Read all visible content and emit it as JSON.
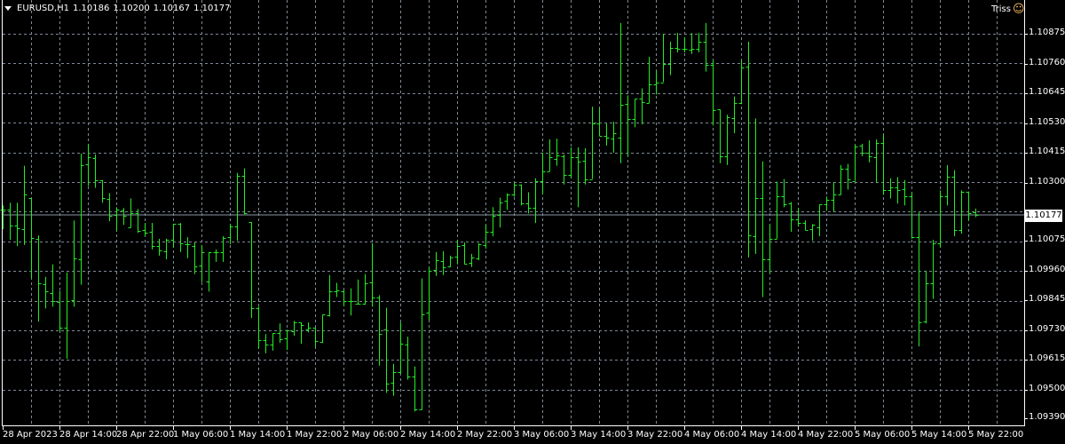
{
  "header": {
    "symbol_tf": "EURUSD,H1",
    "open": "1.10186",
    "high": "1.10200",
    "low": "1.10167",
    "close": "1.10177"
  },
  "expert": {
    "name": "Triss",
    "icon": "smiley-icon"
  },
  "colors": {
    "bar": "#22ee22",
    "grid": "#7d8896",
    "price_line": "#8a96a6",
    "background": "#000000"
  },
  "chart_data": {
    "type": "ohlc",
    "title": "EURUSD,H1",
    "ylim": [
      1.0939,
      1.10875
    ],
    "grid": true,
    "current_price": "1.10177",
    "y_ticks": [
      "1.10875",
      "1.10760",
      "1.10645",
      "1.10530",
      "1.10415",
      "1.10300",
      "1.10075",
      "1.09960",
      "1.09845",
      "1.09730",
      "1.09615",
      "1.09500",
      "1.09390"
    ],
    "x_ticks": [
      "28 Apr 2023",
      "28 Apr 14:00",
      "28 Apr 22:00",
      "1 May 06:00",
      "1 May 14:00",
      "1 May 22:00",
      "2 May 06:00",
      "2 May 14:00",
      "2 May 22:00",
      "3 May 06:00",
      "3 May 14:00",
      "3 May 22:00",
      "4 May 06:00",
      "4 May 14:00",
      "4 May 22:00",
      "5 May 06:00",
      "5 May 14:00",
      "5 May 22:00"
    ],
    "ohlc_fields": [
      "open",
      "high",
      "low",
      "close"
    ],
    "ohlc": [
      [
        1.10195,
        1.10212,
        1.1012,
        1.10195
      ],
      [
        1.10195,
        1.10222,
        1.10079,
        1.10134
      ],
      [
        1.10134,
        1.10222,
        1.10055,
        1.10123
      ],
      [
        1.1012,
        1.10365,
        1.10059,
        1.10253
      ],
      [
        1.10239,
        1.10239,
        1.0993,
        1.10086
      ],
      [
        1.10083,
        1.10096,
        1.09763,
        1.09913
      ],
      [
        1.09909,
        1.09936,
        1.09814,
        1.09879
      ],
      [
        1.09875,
        1.09984,
        1.09821,
        1.09841
      ],
      [
        1.09838,
        1.09882,
        1.09722,
        1.09739
      ],
      [
        1.09739,
        1.09953,
        1.0962,
        1.09841
      ],
      [
        1.09845,
        1.10154,
        1.09821,
        1.10008
      ],
      [
        1.10004,
        1.10412,
        1.09906,
        1.10368
      ],
      [
        1.10372,
        1.1045,
        1.10287,
        1.10399
      ],
      [
        1.10395,
        1.10409,
        1.1028,
        1.1031
      ],
      [
        1.1031,
        1.1031,
        1.10222,
        1.10239
      ],
      [
        1.10236,
        1.10259,
        1.10151,
        1.10171
      ],
      [
        1.10174,
        1.10205,
        1.10113,
        1.10195
      ],
      [
        1.10191,
        1.10202,
        1.10137,
        1.10171
      ],
      [
        1.10127,
        1.10239,
        1.10127,
        1.10181
      ],
      [
        1.10181,
        1.10198,
        1.10106,
        1.10113
      ],
      [
        1.10117,
        1.10144,
        1.10093,
        1.10106
      ],
      [
        1.1011,
        1.10144,
        1.10042,
        1.10055
      ],
      [
        1.10055,
        1.10083,
        1.10018,
        1.10038
      ],
      [
        1.10035,
        1.10083,
        1.10004,
        1.10079
      ],
      [
        1.10079,
        1.1014,
        1.10049,
        1.1014
      ],
      [
        1.1014,
        1.10144,
        1.10032,
        1.10066
      ],
      [
        1.10062,
        1.10089,
        1.10008,
        1.10062
      ],
      [
        1.10055,
        1.10069,
        1.09947,
        1.09977
      ],
      [
        1.09981,
        1.10059,
        1.09916,
        1.10032
      ],
      [
        1.09919,
        1.10032,
        1.09879,
        1.10032
      ],
      [
        1.10032,
        1.10042,
        1.09994,
        1.10032
      ],
      [
        1.10032,
        1.10093,
        1.09994,
        1.10086
      ],
      [
        1.10089,
        1.1014,
        1.10062,
        1.1013
      ],
      [
        1.1013,
        1.10338,
        1.10076,
        1.10327
      ],
      [
        1.10327,
        1.10355,
        1.10178,
        1.10181
      ],
      [
        1.10147,
        1.10147,
        1.09777,
        1.09814
      ],
      [
        1.09814,
        1.09821,
        1.09658,
        1.09692
      ],
      [
        1.09692,
        1.09715,
        1.09641,
        1.09675
      ],
      [
        1.09675,
        1.09719,
        1.09651,
        1.09719
      ],
      [
        1.09719,
        1.09756,
        1.09681,
        1.09695
      ],
      [
        1.09698,
        1.09732,
        1.09654,
        1.09729
      ],
      [
        1.09726,
        1.09766,
        1.09709,
        1.0976
      ],
      [
        1.0976,
        1.0976,
        1.09678,
        1.09749
      ],
      [
        1.09732,
        1.0976,
        1.09722,
        1.09739
      ],
      [
        1.09739,
        1.09739,
        1.09664,
        1.09688
      ],
      [
        1.09685,
        1.0979,
        1.09681,
        1.0979
      ],
      [
        1.09787,
        1.09943,
        1.09783,
        1.09882
      ],
      [
        1.09882,
        1.09913,
        1.09858,
        1.09885
      ],
      [
        1.09882,
        1.09885,
        1.09824,
        1.09841
      ],
      [
        1.09841,
        1.09892,
        1.09787,
        1.09841
      ],
      [
        1.09834,
        1.09926,
        1.09831,
        1.09831
      ],
      [
        1.09831,
        1.09947,
        1.09828,
        1.09913
      ],
      [
        1.09916,
        1.10066,
        1.09821,
        1.09858
      ],
      [
        1.09855,
        1.09865,
        1.09593,
        1.09715
      ],
      [
        1.09732,
        1.09817,
        1.09488,
        1.09525
      ],
      [
        1.09528,
        1.096,
        1.09477,
        1.09569
      ],
      [
        1.09569,
        1.0976,
        1.09562,
        1.09678
      ],
      [
        1.09675,
        1.09705,
        1.09539,
        1.09552
      ],
      [
        1.09552,
        1.0959,
        1.09416,
        1.09426
      ],
      [
        1.09426,
        1.0993,
        1.09423,
        1.0979
      ],
      [
        1.09797,
        1.09974,
        1.0977,
        1.0996
      ],
      [
        1.09964,
        1.10032,
        1.0994,
        1.10001
      ],
      [
        1.09998,
        1.10035,
        1.09943,
        1.09974
      ],
      [
        1.09977,
        1.10018,
        1.09974,
        1.10011
      ],
      [
        1.10015,
        1.10079,
        1.09984,
        1.10055
      ],
      [
        1.10059,
        1.10069,
        1.09984,
        1.09987
      ],
      [
        1.09991,
        1.10025,
        1.09974,
        1.10011
      ],
      [
        1.10008,
        1.10066,
        1.10001,
        1.10062
      ],
      [
        1.10059,
        1.10137,
        1.10045,
        1.1011
      ],
      [
        1.1011,
        1.10205,
        1.10093,
        1.10171
      ],
      [
        1.10174,
        1.10242,
        1.10127,
        1.10225
      ],
      [
        1.10229,
        1.10259,
        1.10195,
        1.10253
      ],
      [
        1.10253,
        1.103,
        1.10246,
        1.10293
      ],
      [
        1.10293,
        1.10293,
        1.10212,
        1.10219
      ],
      [
        1.10219,
        1.10263,
        1.10181,
        1.10202
      ],
      [
        1.10202,
        1.10317,
        1.10144,
        1.10307
      ],
      [
        1.10307,
        1.10416,
        1.10256,
        1.10344
      ],
      [
        1.10344,
        1.10467,
        1.10344,
        1.10399
      ],
      [
        1.10392,
        1.1047,
        1.10365,
        1.10406
      ],
      [
        1.10402,
        1.10409,
        1.10293,
        1.10331
      ],
      [
        1.10331,
        1.10436,
        1.10317,
        1.10399
      ],
      [
        1.10399,
        1.10436,
        1.10205,
        1.10382
      ],
      [
        1.10385,
        1.10433,
        1.10293,
        1.10314
      ],
      [
        1.10314,
        1.10593,
        1.10314,
        1.10528
      ],
      [
        1.10528,
        1.10589,
        1.1048,
        1.1048
      ],
      [
        1.1048,
        1.10528,
        1.10443,
        1.10474
      ],
      [
        1.1047,
        1.10535,
        1.10416,
        1.10491
      ],
      [
        1.10474,
        1.10916,
        1.10375,
        1.10599
      ],
      [
        1.10603,
        1.10637,
        1.10402,
        1.10545
      ],
      [
        1.10545,
        1.10623,
        1.10514,
        1.10623
      ],
      [
        1.10623,
        1.10664,
        1.10525,
        1.1061
      ],
      [
        1.10606,
        1.10786,
        1.10606,
        1.10681
      ],
      [
        1.10678,
        1.10732,
        1.1064,
        1.10688
      ],
      [
        1.10688,
        1.10875,
        1.10688,
        1.10759
      ],
      [
        1.10759,
        1.10844,
        1.10715,
        1.1082
      ],
      [
        1.1082,
        1.10878,
        1.10803,
        1.10817
      ],
      [
        1.10817,
        1.10861,
        1.10803,
        1.10817
      ],
      [
        1.10814,
        1.10878,
        1.10797,
        1.10817
      ],
      [
        1.10817,
        1.10878,
        1.10803,
        1.10844
      ],
      [
        1.10844,
        1.10916,
        1.10729,
        1.10756
      ],
      [
        1.10756,
        1.10773,
        1.10521,
        1.10579
      ],
      [
        1.10582,
        1.10582,
        1.10375,
        1.10402
      ],
      [
        1.10402,
        1.10562,
        1.10368,
        1.10552
      ],
      [
        1.10548,
        1.10633,
        1.10491,
        1.10606
      ],
      [
        1.10606,
        1.10773,
        1.10603,
        1.10746
      ],
      [
        1.10749,
        1.10844,
        1.10011,
        1.10096
      ],
      [
        1.10093,
        1.10548,
        1.10025,
        1.10239
      ],
      [
        1.10239,
        1.10382,
        1.09858,
        1.10004
      ],
      [
        1.10004,
        1.1014,
        1.0995,
        1.10083
      ],
      [
        1.10083,
        1.10304,
        1.10083,
        1.10249
      ],
      [
        1.10249,
        1.10314,
        1.10205,
        1.10215
      ],
      [
        1.10219,
        1.10225,
        1.1011,
        1.10157
      ],
      [
        1.10157,
        1.10202,
        1.1013,
        1.10144
      ],
      [
        1.10144,
        1.10154,
        1.10117,
        1.10117
      ],
      [
        1.1012,
        1.1014,
        1.10076,
        1.10137
      ],
      [
        1.10127,
        1.10215,
        1.10093,
        1.10215
      ],
      [
        1.10215,
        1.10246,
        1.10191,
        1.10232
      ],
      [
        1.10232,
        1.103,
        1.10188,
        1.10253
      ],
      [
        1.10253,
        1.10368,
        1.10253,
        1.10355
      ],
      [
        1.10355,
        1.10372,
        1.10273,
        1.10314
      ],
      [
        1.10307,
        1.10446,
        1.10307,
        1.1044
      ],
      [
        1.10443,
        1.1045,
        1.10402,
        1.10416
      ],
      [
        1.10416,
        1.10463,
        1.10378,
        1.10402
      ],
      [
        1.10399,
        1.10467,
        1.103,
        1.10453
      ],
      [
        1.10453,
        1.10487,
        1.10253,
        1.1027
      ],
      [
        1.10273,
        1.10317,
        1.10239,
        1.10283
      ],
      [
        1.10283,
        1.10321,
        1.10219,
        1.10273
      ],
      [
        1.10276,
        1.1031,
        1.10212,
        1.10249
      ],
      [
        1.10249,
        1.10263,
        1.10083,
        1.10089
      ],
      [
        1.10089,
        1.10185,
        1.09668,
        1.0976
      ],
      [
        1.09763,
        1.0996,
        1.09756,
        1.09913
      ],
      [
        1.09913,
        1.10079,
        1.09851,
        1.10066
      ],
      [
        1.10066,
        1.1027,
        1.10049,
        1.10249
      ],
      [
        1.10249,
        1.10368,
        1.10212,
        1.10324
      ],
      [
        1.10324,
        1.10348,
        1.10093,
        1.10117
      ],
      [
        1.10117,
        1.1027,
        1.10103,
        1.10266
      ],
      [
        1.10263,
        1.10266,
        1.10154,
        1.10181
      ],
      [
        1.10186,
        1.102,
        1.10167,
        1.10177
      ]
    ]
  }
}
